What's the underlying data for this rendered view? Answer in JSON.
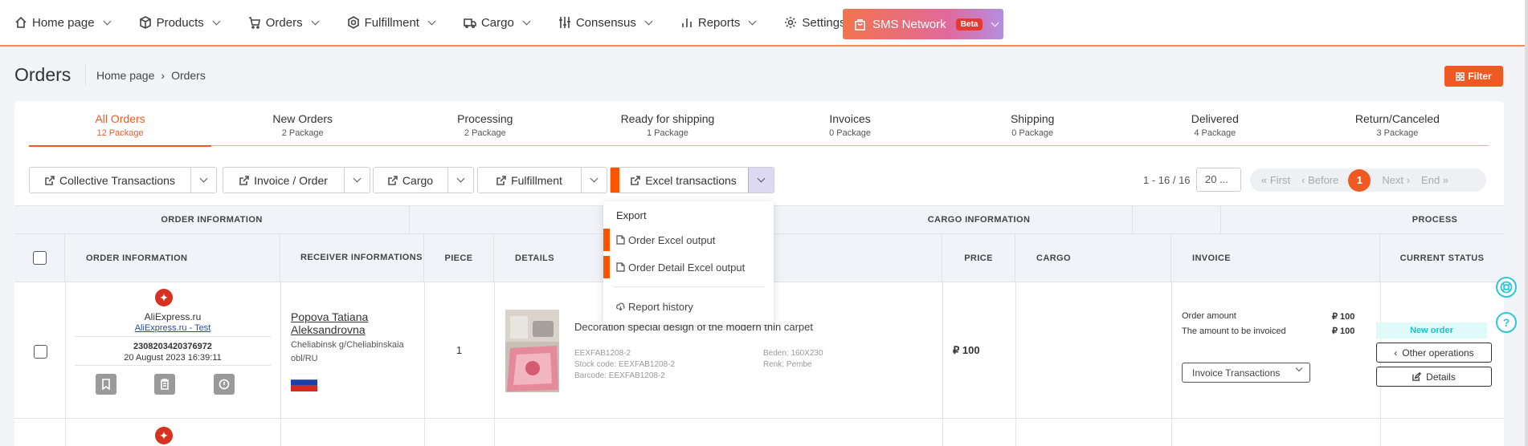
{
  "nav": {
    "items": [
      {
        "label": "Home page",
        "icon": "home-icon"
      },
      {
        "label": "Products",
        "icon": "box-icon"
      },
      {
        "label": "Orders",
        "icon": "cart-icon"
      },
      {
        "label": "Fulfillment",
        "icon": "hex-icon"
      },
      {
        "label": "Cargo",
        "icon": "truck-icon"
      },
      {
        "label": "Consensus",
        "icon": "sliders-icon"
      },
      {
        "label": "Reports",
        "icon": "bar-chart-icon"
      },
      {
        "label": "Settings",
        "icon": "gear-icon"
      }
    ],
    "sms": {
      "label": "SMS Network",
      "badge": "Beta"
    }
  },
  "header": {
    "title": "Orders",
    "breadcrumb": [
      "Home page",
      "Orders"
    ],
    "filter_label": "Filter"
  },
  "tabs": [
    {
      "label": "All Orders",
      "count": "12 Package",
      "active": true
    },
    {
      "label": "New Orders",
      "count": "2 Package"
    },
    {
      "label": "Processing",
      "count": "2 Package"
    },
    {
      "label": "Ready for shipping",
      "count": "1 Package"
    },
    {
      "label": "Invoices",
      "count": "0 Package"
    },
    {
      "label": "Shipping",
      "count": "0 Package"
    },
    {
      "label": "Delivered",
      "count": "4 Package"
    },
    {
      "label": "Return/Canceled",
      "count": "3 Package"
    }
  ],
  "toolbar": {
    "collective": "Collective Transactions",
    "invoice": "Invoice / Order",
    "cargo": "Cargo",
    "fulfillment": "Fulfillment",
    "excel": "Excel transactions"
  },
  "pager": {
    "info": "1 - 16 / 16",
    "page_size": "20 ...",
    "first": "« First",
    "before": "‹ Before",
    "current": "1",
    "next": "Next ›",
    "end": "End »"
  },
  "table": {
    "group_headers": {
      "order": "ORDER INFORMATION",
      "cargo": "CARGO INFORMATION",
      "process": "PROCESS"
    },
    "columns": {
      "order_info": "ORDER INFORMATION",
      "receiver": "RECEIVER INFORMATIONS",
      "piece": "PIECE",
      "details": "DETAILS",
      "price": "PRICE",
      "cargo": "CARGO",
      "invoice": "INVOICE",
      "status": "CURRENT STATUS"
    },
    "row": {
      "store": "AliExpress.ru",
      "store_link": "AliExpress.ru - Test",
      "order_no": "2308203420376972",
      "date": "20 August 2023 16:39:11",
      "receiver_name": "Popova Tatiana Aleksandrovna",
      "receiver_city": "Cheliabinsk g/Cheliabinskaia obl/RU",
      "piece": "1",
      "product_title": "Decoration special design of the modern thin carpet",
      "sku": "EEXFAB1208-2",
      "stock_code": "Stock code: EEXFAB1208-2",
      "barcode": "Barcode: EEXFAB1208-2",
      "size": "Beden: 160X230",
      "color": "Renk: Pembe",
      "price": "₽ 100",
      "order_amount_label": "Order amount",
      "order_amount": "₽ 100",
      "invoiced_label": "The amount to be invoiced",
      "invoiced_amount": "₽ 100",
      "invoice_select": "Invoice Transactions",
      "status": "New order",
      "other_ops": "Other operations",
      "details_btn": "Details"
    }
  },
  "menu": {
    "header": "Export",
    "items": [
      "Order Excel output",
      "Order Detail Excel output",
      "Report history"
    ]
  },
  "colors": {
    "accent": "#f05a22",
    "teal": "#2dc6d6"
  }
}
